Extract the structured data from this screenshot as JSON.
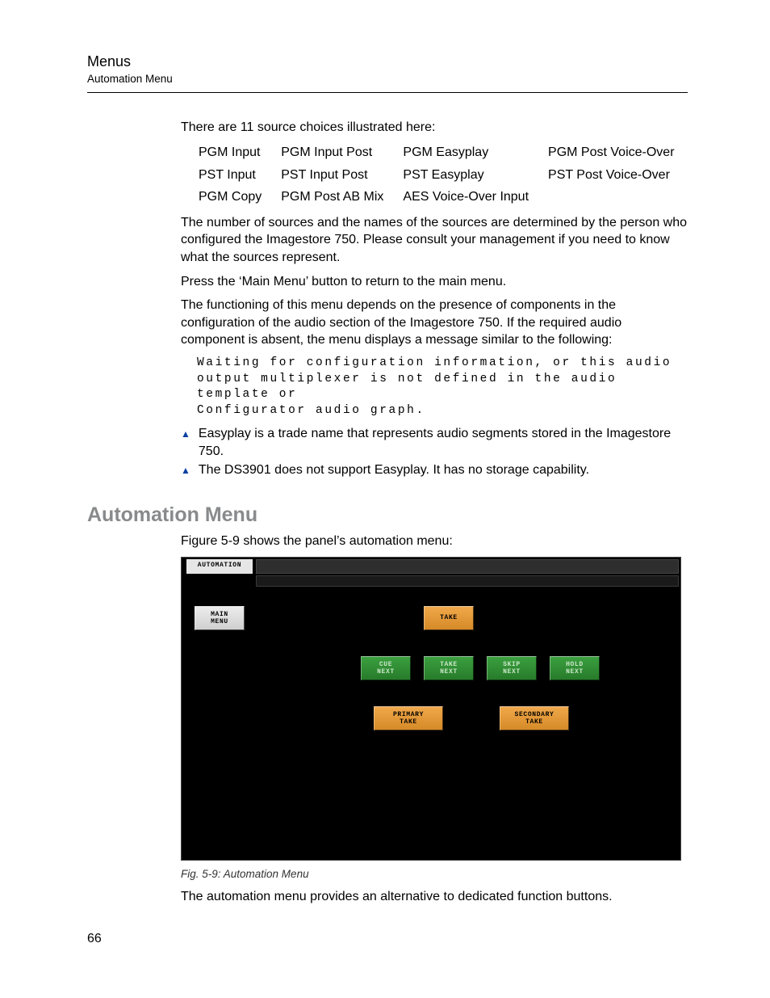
{
  "header": {
    "title": "Menus",
    "subtitle": "Automation Menu"
  },
  "p1": "There are 11 source choices illustrated here:",
  "sources": {
    "r0c0": "PGM Input",
    "r0c1": "PGM Input Post",
    "r0c2": "PGM Easyplay",
    "r0c3": "PGM Post Voice-Over",
    "r1c0": "PST Input",
    "r1c1": "PST Input Post",
    "r1c2": "PST Easyplay",
    "r1c3": "PST Post Voice-Over",
    "r2c0": "PGM Copy",
    "r2c1": "PGM Post AB Mix",
    "r2c2": "AES Voice-Over Input",
    "r2c3": ""
  },
  "p2": "The number of sources and the names of the sources are determined by the person who configured the Imagestore 750. Please consult your management if you need to know what the sources represent.",
  "p3": "Press the ‘Main Menu’ button to return to the main menu.",
  "p4": "The functioning of this menu depends on the presence of components in the configuration of the audio section of the Imagestore 750. If the required audio component is absent, the menu displays a message similar to the following:",
  "code": {
    "l1": "Waiting for configuration information, or this audio",
    "l2": "output multiplexer is not defined in the audio template or",
    "l3": "Configurator audio graph."
  },
  "notes": {
    "n1": "Easyplay is a trade name that represents audio segments stored in the Imagestore 750.",
    "n2": "The DS3901 does not support Easyplay. It has no storage capability."
  },
  "section_heading": "Automation Menu",
  "p5": "Figure 5-9 shows the panel’s automation menu:",
  "panel": {
    "tab": "AUTOMATION",
    "main_menu": "MAIN\nMENU",
    "take": "TAKE",
    "cue_next": "CUE\nNEXT",
    "take_next": "TAKE\nNEXT",
    "skip_next": "SKIP\nNEXT",
    "hold_next": "HOLD\nNEXT",
    "primary_take": "PRIMARY\nTAKE",
    "secondary_take": "SECONDARY\nTAKE"
  },
  "fig_caption": "Fig. 5-9: Automation Menu",
  "p6": "The automation menu provides an alternative to dedicated function buttons.",
  "page_number": "66"
}
